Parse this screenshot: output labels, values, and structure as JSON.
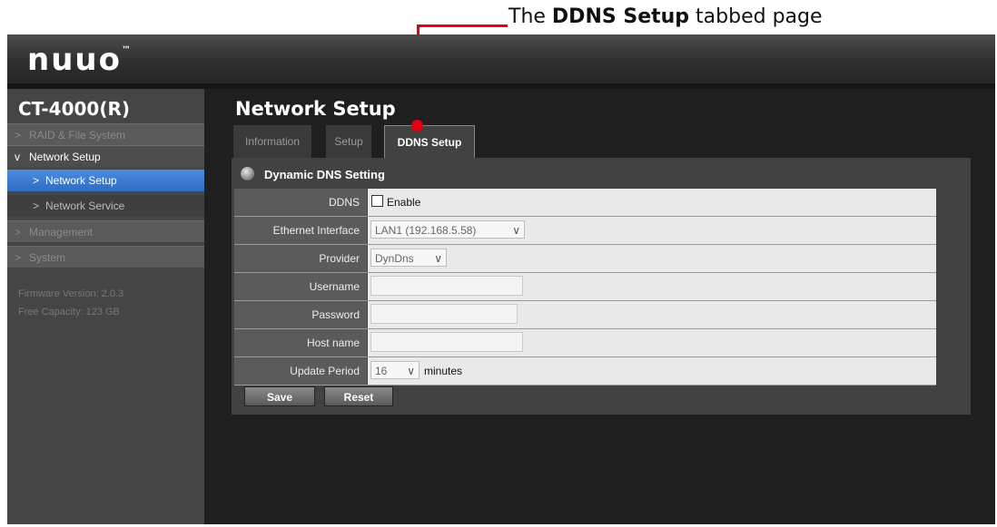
{
  "annotation": {
    "prefix": "The ",
    "bold": "DDNS Setup",
    "suffix": " tabbed page",
    "color": "#e3000f"
  },
  "app": {
    "logo": "nuuo",
    "trademark": "™"
  },
  "sidebar": {
    "device": "CT-4000(R)",
    "items": [
      {
        "label": "RAID & File System",
        "chevron": ">"
      },
      {
        "label": "Network Setup",
        "chevron": "v"
      },
      {
        "label": "Network Setup",
        "chevron": ">"
      },
      {
        "label": "Network Service",
        "chevron": ">"
      },
      {
        "label": "Management",
        "chevron": ">"
      },
      {
        "label": "System",
        "chevron": ">"
      }
    ],
    "firmware": "Firmware Version: 2.0.3",
    "capacity": "Free Capacity: 123 GB"
  },
  "main": {
    "title": "Network Setup",
    "tabs": [
      {
        "label": "Information"
      },
      {
        "label": "Setup"
      },
      {
        "label": "DDNS Setup",
        "active": true
      }
    ],
    "section_title": "Dynamic DNS Setting",
    "form": {
      "ddns_label": "DDNS",
      "ddns_enable": "Enable",
      "ddns_checked": false,
      "iface_label": "Ethernet Interface",
      "iface_value": "LAN1 (192.168.5.58)",
      "provider_label": "Provider",
      "provider_value": "DynDns",
      "username_label": "Username",
      "username_value": "",
      "password_label": "Password",
      "password_value": "",
      "hostname_label": "Host name",
      "hostname_value": "",
      "period_label": "Update Period",
      "period_value": "16",
      "period_unit": "minutes"
    },
    "buttons": {
      "save": "Save",
      "reset": "Reset"
    }
  },
  "icons": {
    "dropdown": "chevron-down-icon",
    "nav_chevron": "chevron-right-icon"
  }
}
